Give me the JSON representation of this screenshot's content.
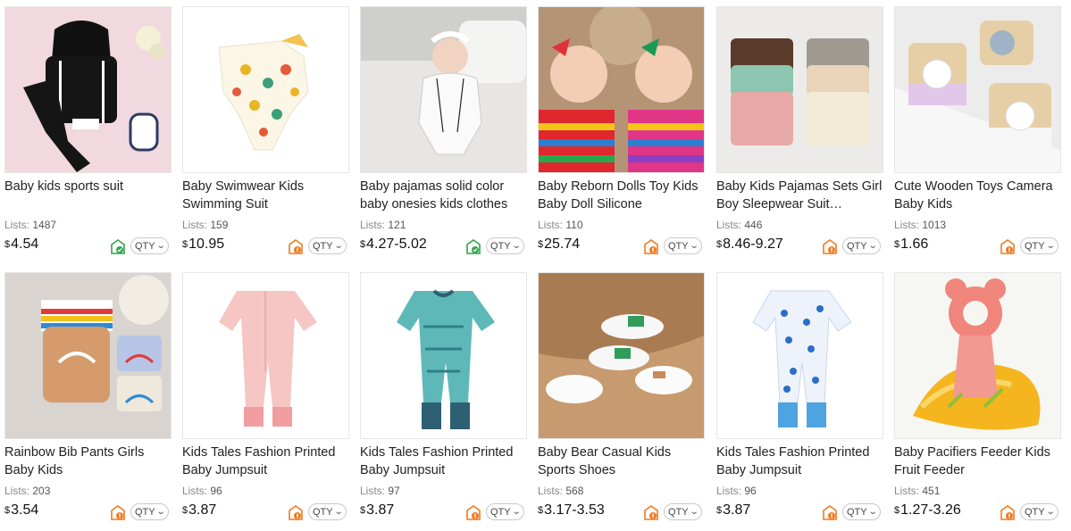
{
  "labels": {
    "lists_prefix": "Lists:",
    "currency": "$",
    "qty": "QTY"
  },
  "colors": {
    "badge_green": "#2fa64a",
    "badge_orange": "#f07a1f",
    "price_text": "#111111"
  },
  "products": [
    {
      "title": "Baby kids sports suit",
      "lists": "1487",
      "price": "4.54",
      "badge": "green"
    },
    {
      "title": "Baby Swimwear Kids Swimming Suit",
      "lists": "159",
      "price": "10.95",
      "badge": "orange"
    },
    {
      "title": "Baby pajamas solid color baby onesies kids clothes",
      "lists": "121",
      "price": "4.27-5.02",
      "badge": "green"
    },
    {
      "title": "Baby Reborn Dolls Toy Kids Baby Doll Silicone",
      "lists": "110",
      "price": "25.74",
      "badge": "orange"
    },
    {
      "title": "Baby Kids Pajamas Sets Girl Boy Sleepwear Suit Autumn...",
      "lists": "446",
      "price": "8.46-9.27",
      "badge": "orange"
    },
    {
      "title": "Cute Wooden Toys Camera Baby Kids",
      "lists": "1013",
      "price": "1.66",
      "badge": "orange"
    },
    {
      "title": "Rainbow Bib Pants Girls Baby Kids",
      "lists": "203",
      "price": "3.54",
      "badge": "orange"
    },
    {
      "title": "Kids Tales Fashion Printed Baby Jumpsuit",
      "lists": "96",
      "price": "3.87",
      "badge": "orange"
    },
    {
      "title": "Kids Tales Fashion Printed Baby Jumpsuit",
      "lists": "97",
      "price": "3.87",
      "badge": "orange"
    },
    {
      "title": "Baby Bear Casual Kids Sports Shoes",
      "lists": "568",
      "price": "3.17-3.53",
      "badge": "orange"
    },
    {
      "title": "Kids Tales Fashion Printed Baby Jumpsuit",
      "lists": "96",
      "price": "3.87",
      "badge": "orange"
    },
    {
      "title": "Baby Pacifiers Feeder Kids Fruit Feeder",
      "lists": "451",
      "price": "1.27-3.26",
      "badge": "orange"
    }
  ]
}
